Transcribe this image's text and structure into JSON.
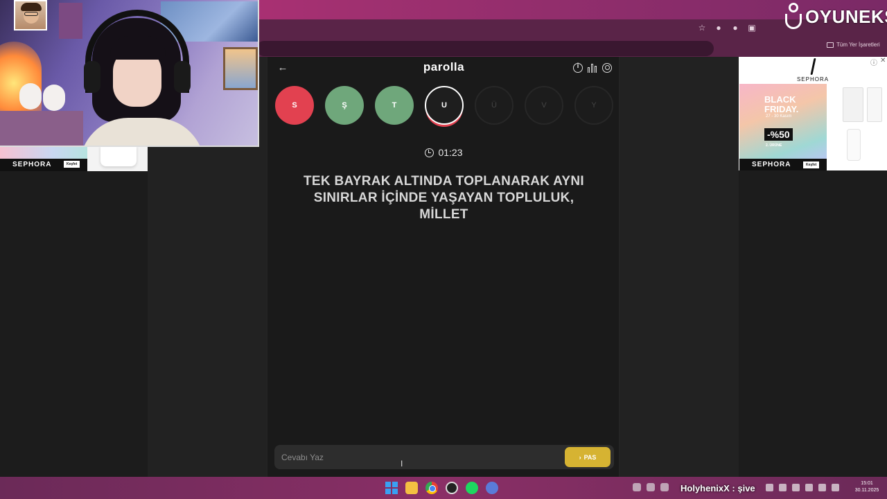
{
  "browser": {
    "bookmarks_folder": "Tüm Yer İşaretleri"
  },
  "watermark": {
    "brand": "OYUNEKS"
  },
  "game": {
    "title": "parolla",
    "letters": [
      {
        "letter": "S",
        "status": "wrong"
      },
      {
        "letter": "Ş",
        "status": "correct"
      },
      {
        "letter": "T",
        "status": "correct"
      },
      {
        "letter": "U",
        "status": "current"
      },
      {
        "letter": "Ü",
        "status": "pending"
      },
      {
        "letter": "V",
        "status": "pending"
      },
      {
        "letter": "Y",
        "status": "pending"
      }
    ],
    "timer": "01:23",
    "question": "TEK BAYRAK ALTINDA TOPLANARAK AYNI SINIRLAR İÇİNDE YAŞAYAN TOPLULUK, MİLLET",
    "answer_placeholder": "Cevabı Yaz",
    "pass_label": "PAS"
  },
  "ads": {
    "left": {
      "brand": "SEPHORA",
      "cta": "Keşfet"
    },
    "right": {
      "brand": "SEPHORA",
      "headline": "BLACK FRIDAY.",
      "dates": "27 - 30 Kasım",
      "discount": "-%50",
      "discount_note": "2. ÜRÜNE",
      "cta": "Keşfet"
    }
  },
  "taskbar": {
    "chat": "HolyhenixX : şive",
    "time": "15:01",
    "date": "30.11.2025"
  },
  "colors": {
    "wrong": "#e24150",
    "correct": "#6fa77b",
    "pass_button": "#d6b332"
  }
}
